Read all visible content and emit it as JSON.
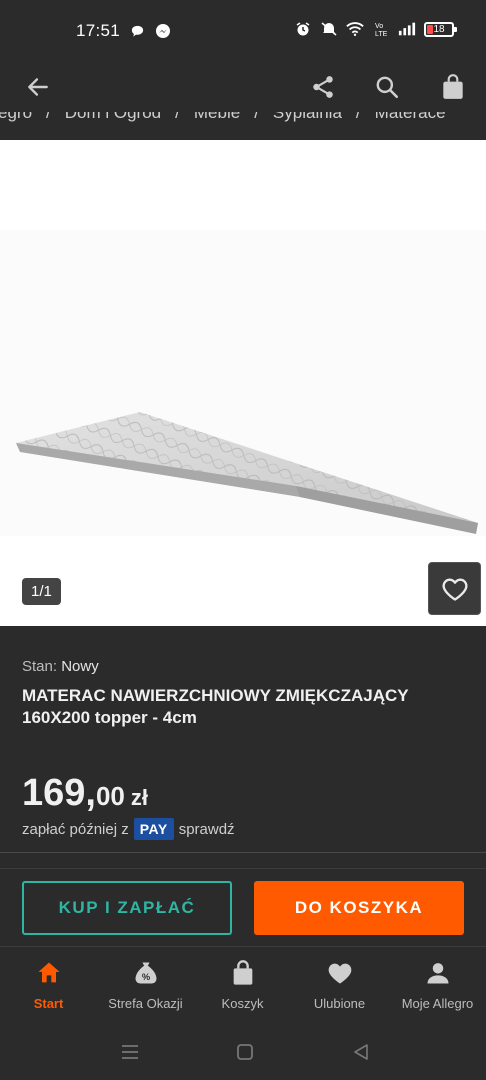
{
  "status_bar": {
    "time": "17:51",
    "battery": "18",
    "icons": [
      "chat-bubble-icon",
      "messenger-icon",
      "alarm-icon",
      "mute-icon",
      "wifi-icon",
      "volte-icon",
      "signal-icon",
      "battery-icon"
    ]
  },
  "app_bar": {
    "back_icon": "arrow-left-icon",
    "share_icon": "share-icon",
    "search_icon": "search-icon",
    "bag_icon": "shopping-bag-icon"
  },
  "breadcrumb": {
    "items": [
      "egro",
      "Dom i Ogród",
      "Meble",
      "Sypialnia",
      "Materace"
    ]
  },
  "gallery": {
    "counter": "1/1",
    "favorite_icon": "heart-outline-icon"
  },
  "product": {
    "condition_label": "Stan:",
    "condition_value": "Nowy",
    "title": "MATERAC NAWIERZCHNIOWY ZMIĘKCZAJĄCY 160X200 topper - 4cm",
    "price_int": "169,",
    "price_dec": "00",
    "currency": "zł",
    "pay_later_prefix": "zapłać później z",
    "pay_badge": "PAY",
    "pay_later_link": "sprawdź"
  },
  "actions": {
    "buy_now": "KUP I ZAPŁAĆ",
    "add_to_cart": "DO KOSZYKA"
  },
  "bottom_nav": {
    "items": [
      {
        "label": "Start",
        "icon": "home-icon",
        "active": true
      },
      {
        "label": "Strefa Okazji",
        "icon": "discount-bag-icon",
        "active": false
      },
      {
        "label": "Koszyk",
        "icon": "cart-bag-icon",
        "active": false
      },
      {
        "label": "Ulubione",
        "icon": "heart-icon",
        "active": false
      },
      {
        "label": "Moje Allegro",
        "icon": "person-icon",
        "active": false
      }
    ]
  },
  "colors": {
    "background": "#2b2b2b",
    "accent_orange": "#ff5a00",
    "accent_teal": "#2fb5a4",
    "pay_blue": "#1d4fa0"
  }
}
